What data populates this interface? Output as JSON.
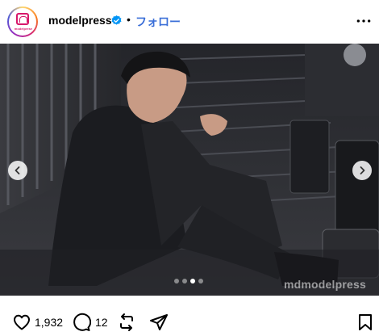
{
  "header": {
    "username": "modelpress",
    "avatar_logo_text": "modelpress",
    "separator": "•",
    "follow_label": "フォロー",
    "verified_icon": "verified-badge-icon",
    "more_icon": "more-dots-icon"
  },
  "photo": {
    "watermark": "mdmodelpress",
    "carousel": {
      "total": 4,
      "active_index": 2
    },
    "prev_icon": "chevron-left-icon",
    "next_icon": "chevron-right-icon"
  },
  "actions": {
    "like_count": "1,932",
    "comment_count": "12",
    "icons": [
      "heart-icon",
      "comment-icon",
      "repost-icon",
      "share-icon",
      "bookmark-icon"
    ]
  },
  "colors": {
    "brand": "#d8186b",
    "follow": "#3b6fd8",
    "verified": "#0095f6"
  }
}
